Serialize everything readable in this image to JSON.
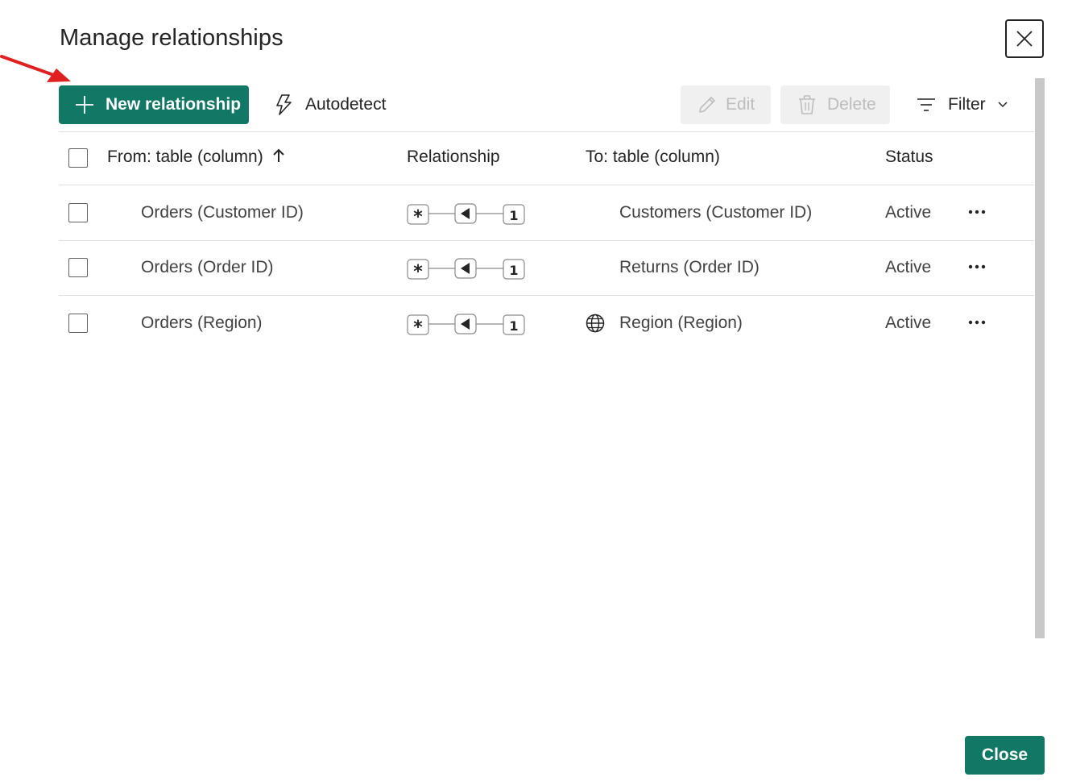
{
  "dialog": {
    "title": "Manage relationships",
    "close_icon": "close-icon"
  },
  "toolbar": {
    "new_relationship_label": "New relationship",
    "autodetect_label": "Autodetect",
    "edit_label": "Edit",
    "delete_label": "Delete",
    "filter_label": "Filter",
    "accent_color": "#117865"
  },
  "table": {
    "headers": {
      "from": "From: table (column)",
      "relationship": "Relationship",
      "to": "To: table (column)",
      "status": "Status"
    },
    "sort_indicator": "ascending",
    "rows": [
      {
        "from": "Orders (Customer ID)",
        "rel_from": "*",
        "rel_to": "1",
        "to": "Customers (Customer ID)",
        "to_icon": "",
        "status": "Active"
      },
      {
        "from": "Orders (Order ID)",
        "rel_from": "*",
        "rel_to": "1",
        "to": "Returns (Order ID)",
        "to_icon": "",
        "status": "Active"
      },
      {
        "from": "Orders (Region)",
        "rel_from": "*",
        "rel_to": "1",
        "to": "Region (Region)",
        "to_icon": "globe-icon",
        "status": "Active"
      }
    ]
  },
  "footer": {
    "close_label": "Close"
  }
}
